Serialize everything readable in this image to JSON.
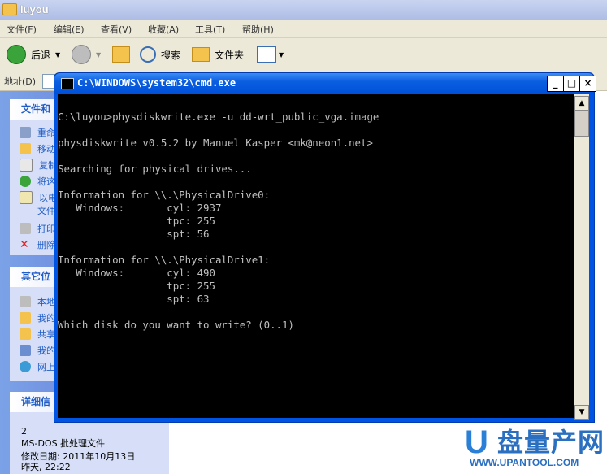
{
  "explorer": {
    "title": "luyou",
    "menu": [
      "文件(F)",
      "编辑(E)",
      "查看(V)",
      "收藏(A)",
      "工具(T)",
      "帮助(H)"
    ],
    "toolbar": {
      "back": "后退",
      "search": "搜索",
      "folders": "文件夹"
    },
    "address_label": "地址(D)",
    "left_pane": {
      "tasks_title": "文件和",
      "tasks": [
        "重命",
        "移动",
        "复制",
        "将这",
        "以电",
        "文件",
        "打印",
        "删除"
      ],
      "other_title": "其它位",
      "other": [
        "本地",
        "我的",
        "共享",
        "我的",
        "网上"
      ],
      "details_title": "详细信",
      "details": [
        "2",
        "MS-DOS 批处理文件",
        "修改日期: 2011年10月13日",
        "昨天, 22:22"
      ]
    }
  },
  "cmd": {
    "title": "C:\\WINDOWS\\system32\\cmd.exe",
    "buttons": {
      "minimize": "_",
      "maximize": "□",
      "close": "×"
    },
    "lines": [
      "C:\\luyou>physdiskwrite.exe -u dd-wrt_public_vga.image",
      "",
      "physdiskwrite v0.5.2 by Manuel Kasper <mk@neon1.net>",
      "",
      "Searching for physical drives...",
      "",
      "Information for \\\\.\\PhysicalDrive0:",
      "   Windows:       cyl: 2937",
      "                  tpc: 255",
      "                  spt: 56",
      "",
      "Information for \\\\.\\PhysicalDrive1:",
      "   Windows:       cyl: 490",
      "                  tpc: 255",
      "                  spt: 63",
      "",
      "Which disk do you want to write? (0..1)"
    ]
  },
  "watermark": {
    "logo": "U",
    "text": "盘量产网",
    "url": "WWW.UPANTOOL.COM"
  },
  "colors": {
    "console_bg": "#000000",
    "console_fg": "#c0c0c0",
    "xp_blue": "#0054e3"
  }
}
